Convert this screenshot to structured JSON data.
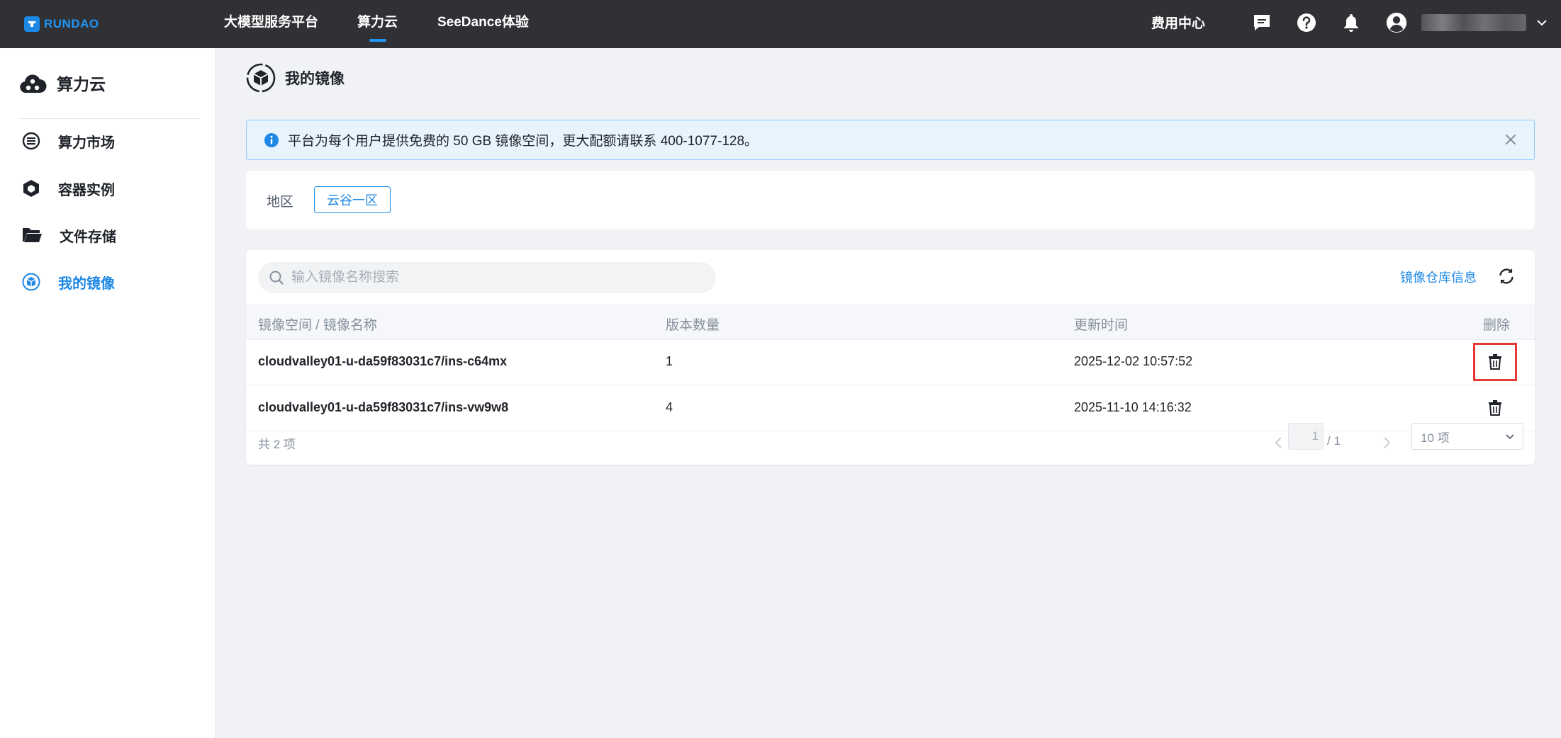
{
  "topbar": {
    "logo_text": "RUNDAO",
    "nav": [
      "大模型服务平台",
      "算力云",
      "SeeDance体验"
    ],
    "active_nav": "算力云",
    "billing": "费用中心"
  },
  "sidebar": {
    "title": "算力云",
    "items": [
      {
        "label": "算力市场",
        "icon": "list-circle-icon"
      },
      {
        "label": "容器实例",
        "icon": "container-icon"
      },
      {
        "label": "文件存储",
        "icon": "folder-icon"
      },
      {
        "label": "我的镜像",
        "icon": "image-cube-icon",
        "active": true
      }
    ]
  },
  "page": {
    "title": "我的镜像"
  },
  "alert": {
    "text": "平台为每个用户提供免费的 50 GB 镜像空间，更大配额请联系 400-1077-128。"
  },
  "region": {
    "label": "地区",
    "selected": "云谷一区"
  },
  "table": {
    "search_placeholder": "输入镜像名称搜索",
    "repo_info": "镜像仓库信息",
    "columns": [
      "镜像空间 / 镜像名称",
      "版本数量",
      "更新时间",
      "删除"
    ],
    "rows": [
      {
        "name": "cloudvalley01-u-da59f83031c7/ins-c64mx",
        "versions": "1",
        "updated": "2025-12-02 10:57:52"
      },
      {
        "name": "cloudvalley01-u-da59f83031c7/ins-vw9w8",
        "versions": "4",
        "updated": "2025-11-10 14:16:32"
      }
    ],
    "total": "共 2 项",
    "page_current": "1",
    "page_total": "/ 1",
    "page_size": "10 项"
  },
  "colors": {
    "accent": "#1e88e5",
    "topbar_bg": "#2f3135",
    "highlight": "#e53935"
  }
}
